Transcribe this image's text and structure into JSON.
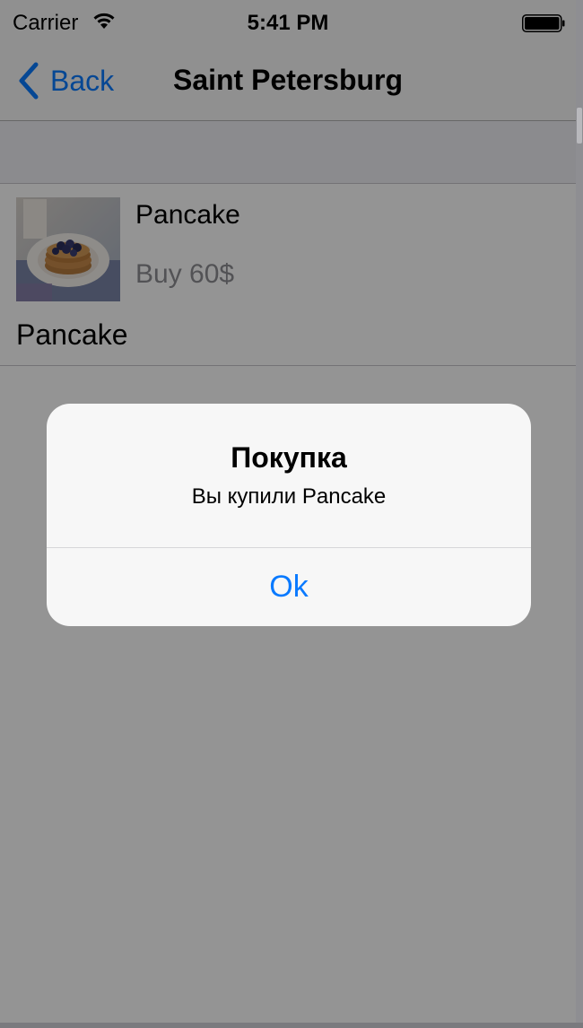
{
  "status_bar": {
    "carrier": "Carrier",
    "time": "5:41 PM",
    "wifi_icon": "wifi-icon",
    "battery_icon": "battery-full-icon"
  },
  "nav_bar": {
    "back_label": "Back",
    "back_icon": "chevron-left-icon",
    "title": "Saint Petersburg"
  },
  "item": {
    "image": "pancake-photo",
    "title": "Pancake",
    "price": "Buy 60$",
    "description": "Pancake"
  },
  "alert": {
    "title": "Покупка",
    "message": "Вы купили Pancake",
    "button_label": "Ok"
  },
  "colors": {
    "tint": "#0a7aff",
    "dim_overlay": "rgba(0,0,0,0.42)",
    "alert_background": "#f7f7f7",
    "secondary_text": "#8e8e93"
  }
}
